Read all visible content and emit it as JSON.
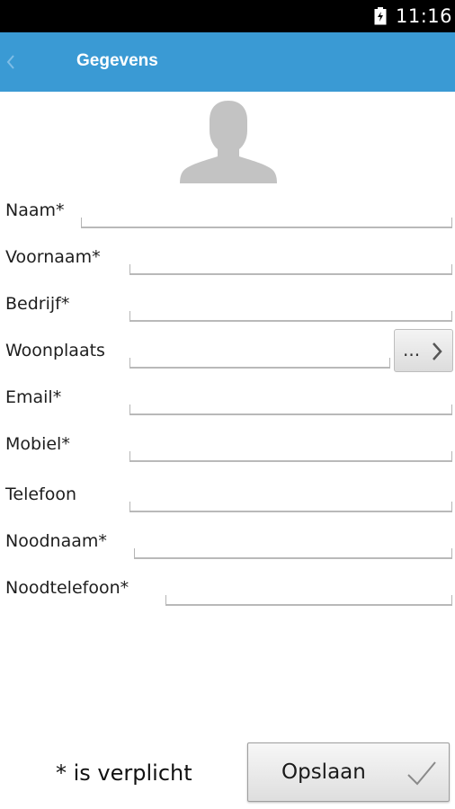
{
  "status_bar": {
    "time": "11:16",
    "battery_icon": "battery-charging-icon"
  },
  "action_bar": {
    "title": "Gegevens",
    "back_icon": "back-chevron-icon",
    "background": "#3a9ad4"
  },
  "avatar": {
    "icon": "person-silhouette-icon"
  },
  "form": {
    "fields": [
      {
        "label": "Naam*",
        "value": "",
        "required": true
      },
      {
        "label": "Voornaam*",
        "value": "",
        "required": true
      },
      {
        "label": "Bedrijf*",
        "value": "",
        "required": true
      },
      {
        "label": "Woonplaats",
        "value": "",
        "required": false
      },
      {
        "label": "Email*",
        "value": "",
        "required": true
      },
      {
        "label": "Mobiel*",
        "value": "",
        "required": true
      },
      {
        "label": "Telefoon",
        "value": "",
        "required": false
      },
      {
        "label": "Noodnaam*",
        "value": "",
        "required": true
      },
      {
        "label": "Noodtelefoon*",
        "value": "",
        "required": true
      }
    ],
    "woonplaats_picker": {
      "label": "...",
      "icon": "chevron-right-icon"
    }
  },
  "footer": {
    "required_note": "* is verplicht",
    "save_label": "Opslaan",
    "save_icon": "checkmark-icon"
  }
}
